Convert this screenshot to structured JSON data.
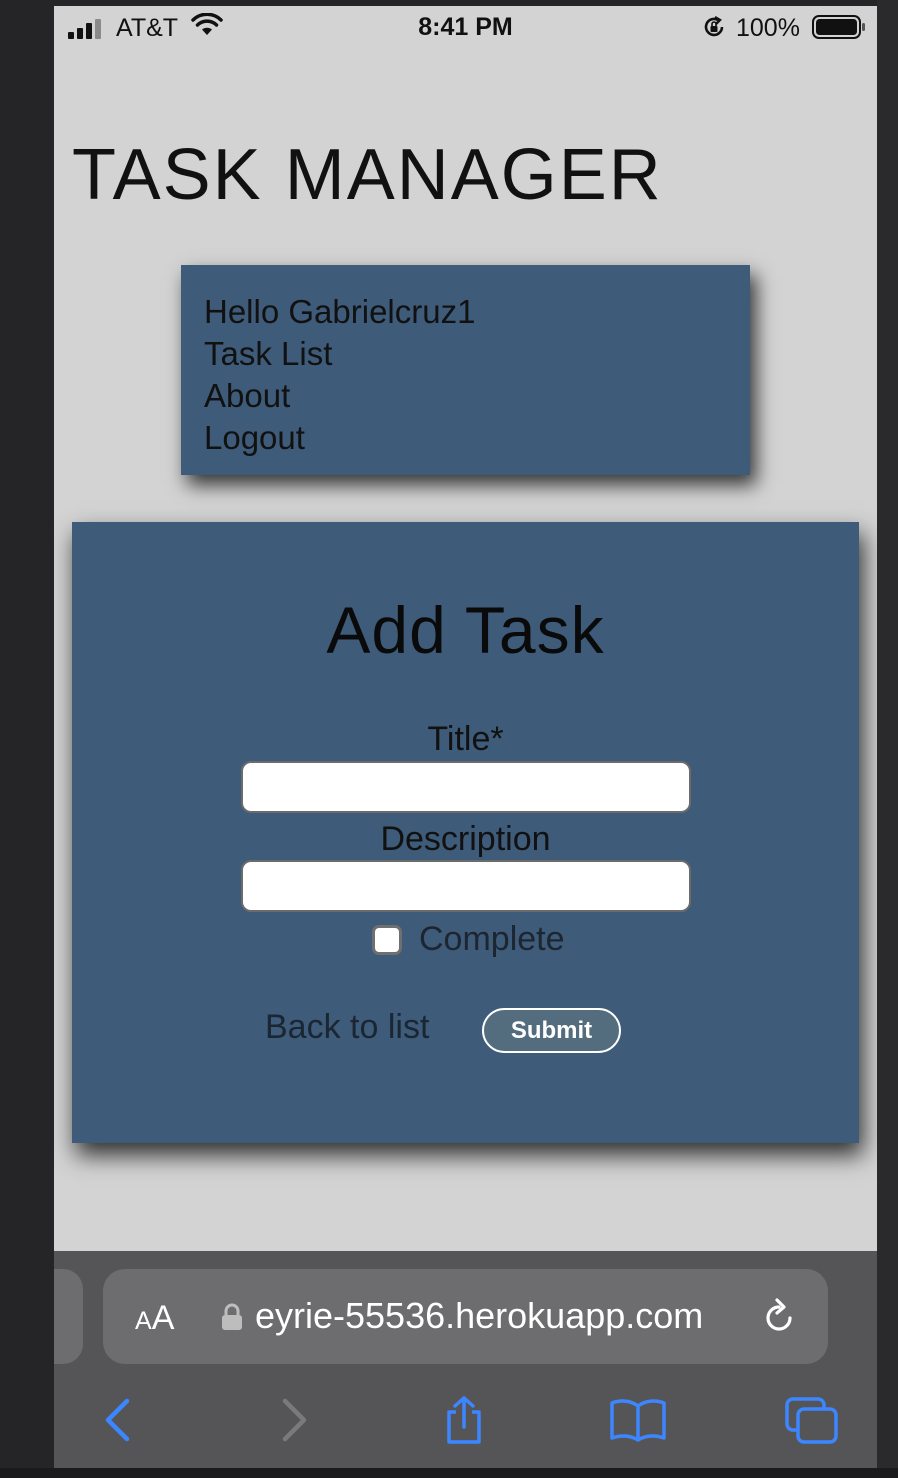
{
  "status_bar": {
    "carrier": "AT&T",
    "time": "8:41 PM",
    "battery": "100%"
  },
  "page": {
    "title": "TASK MANAGER"
  },
  "nav": {
    "items": [
      {
        "label": "Hello Gabrielcruz1"
      },
      {
        "label": "Task List"
      },
      {
        "label": "About"
      },
      {
        "label": "Logout"
      }
    ]
  },
  "form": {
    "heading": "Add Task",
    "title_label": "Title*",
    "title_value": "",
    "description_label": "Description",
    "description_value": "",
    "complete_label": "Complete",
    "complete_checked": false,
    "back_link": "Back to list",
    "submit_label": "Submit"
  },
  "browser": {
    "text_size_label_small": "A",
    "text_size_label_large": "A",
    "url": "eyrie-55536.herokuapp.com"
  },
  "colors": {
    "page_background": "#d3d3d3",
    "panel": "#3e5b7a",
    "submit": "#546d7e",
    "toolbar_icon": "#3c86ff"
  }
}
